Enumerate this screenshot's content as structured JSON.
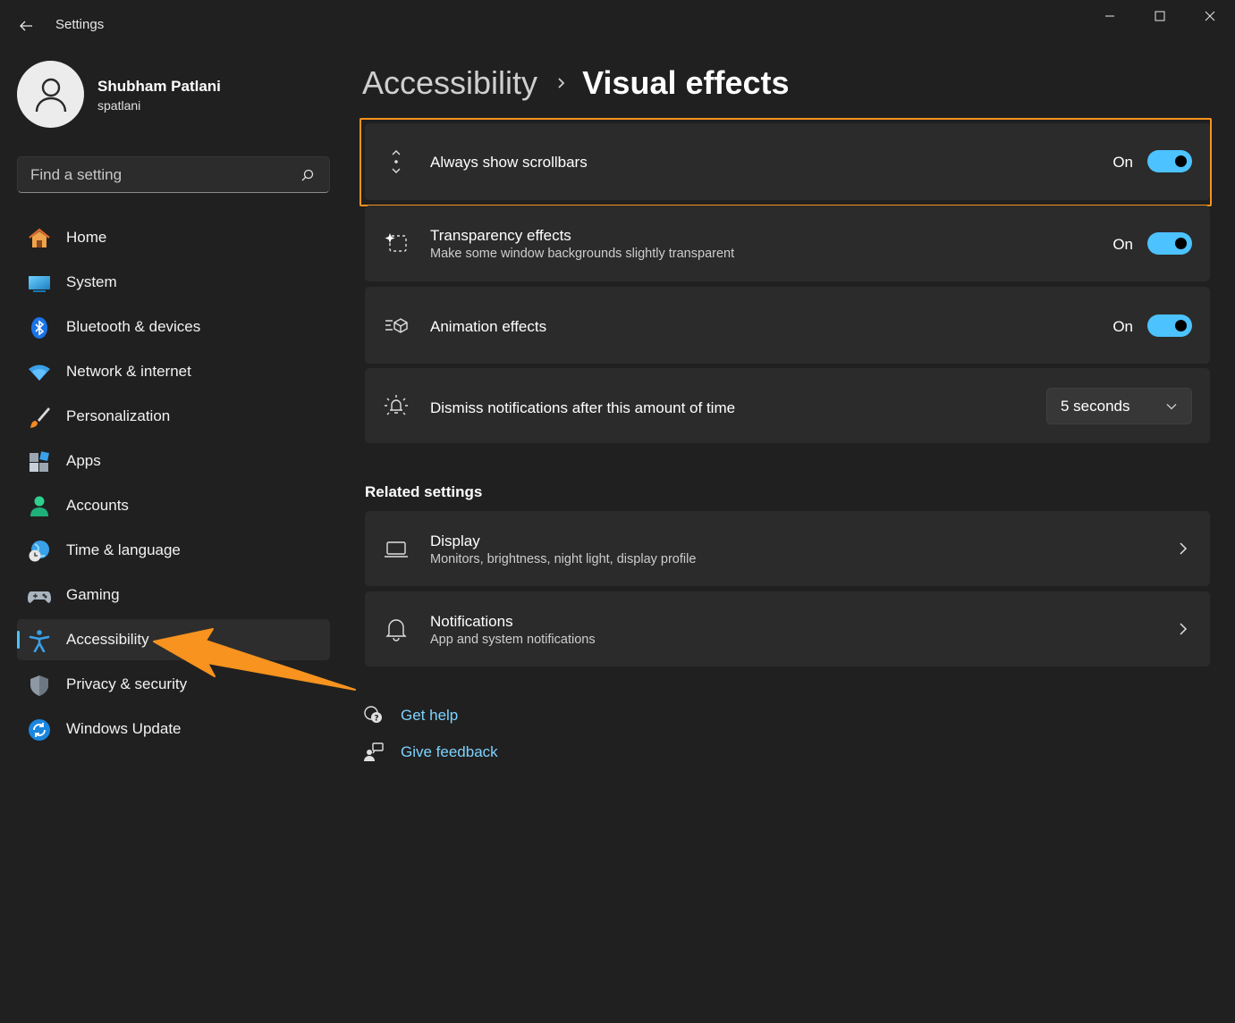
{
  "window": {
    "title": "Settings"
  },
  "profile": {
    "name": "Shubham Patlani",
    "username": "spatlani"
  },
  "search": {
    "placeholder": "Find a setting"
  },
  "nav": {
    "items": [
      {
        "label": "Home",
        "icon": "home-icon"
      },
      {
        "label": "System",
        "icon": "system-icon"
      },
      {
        "label": "Bluetooth & devices",
        "icon": "bluetooth-icon"
      },
      {
        "label": "Network & internet",
        "icon": "wifi-icon"
      },
      {
        "label": "Personalization",
        "icon": "brush-icon"
      },
      {
        "label": "Apps",
        "icon": "apps-icon"
      },
      {
        "label": "Accounts",
        "icon": "accounts-icon"
      },
      {
        "label": "Time & language",
        "icon": "globe-clock-icon"
      },
      {
        "label": "Gaming",
        "icon": "gamepad-icon"
      },
      {
        "label": "Accessibility",
        "icon": "accessibility-icon",
        "active": true
      },
      {
        "label": "Privacy & security",
        "icon": "shield-icon"
      },
      {
        "label": "Windows Update",
        "icon": "update-icon"
      }
    ]
  },
  "breadcrumb": {
    "parent": "Accessibility",
    "current": "Visual effects"
  },
  "settings": {
    "scrollbars": {
      "title": "Always show scrollbars",
      "state": "On"
    },
    "transparency": {
      "title": "Transparency effects",
      "subtitle": "Make some window backgrounds slightly transparent",
      "state": "On"
    },
    "animation": {
      "title": "Animation effects",
      "state": "On"
    },
    "notifications": {
      "title": "Dismiss notifications after this amount of time",
      "value": "5 seconds"
    }
  },
  "related": {
    "heading": "Related settings",
    "display": {
      "title": "Display",
      "subtitle": "Monitors, brightness, night light, display profile"
    },
    "notifications": {
      "title": "Notifications",
      "subtitle": "App and system notifications"
    }
  },
  "links": {
    "help": "Get help",
    "feedback": "Give feedback"
  },
  "colors": {
    "background": "#202020",
    "card": "#2b2b2b",
    "accent": "#4cc2ff",
    "highlight": "#f7931e"
  }
}
